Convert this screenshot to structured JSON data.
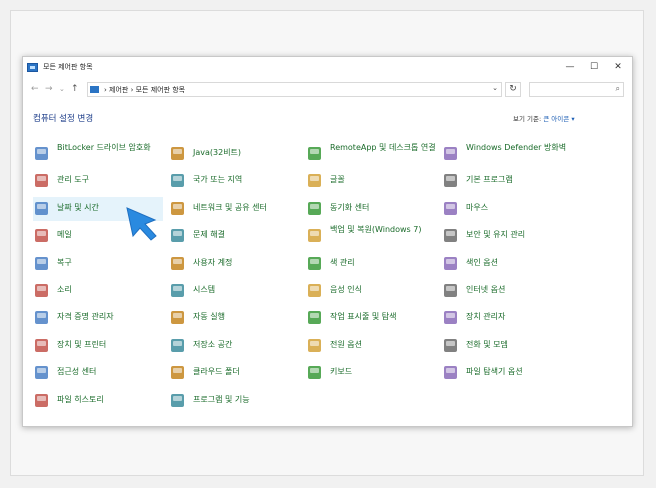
{
  "window": {
    "title": "모든 제어판 항목",
    "min_glyph": "—",
    "max_glyph": "☐",
    "close_glyph": "✕"
  },
  "nav": {
    "back_glyph": "←",
    "forward_glyph": "→",
    "dropdown_glyph": "⌄",
    "up_glyph": "↑",
    "address": "›  제어판  ›  모든 제어판 항목",
    "address_drop": "⌄",
    "refresh_glyph": "↻",
    "search_glyph": "⌕"
  },
  "page": {
    "title": "컴퓨터 설정 변경",
    "view_by_label": "보기 기준:",
    "view_by_value": "큰 아이콘 ▾"
  },
  "items": [
    {
      "label": "BitLocker 드라이브 암호화",
      "icon": "bitlocker-icon"
    },
    {
      "label": "Java(32비트)",
      "icon": "java-icon"
    },
    {
      "label": "RemoteApp 및 데스크톱 연결",
      "icon": "remoteapp-icon"
    },
    {
      "label": "Windows Defender 방화벽",
      "icon": "firewall-icon"
    },
    {
      "label": "관리 도구",
      "icon": "admin-tools-icon"
    },
    {
      "label": "국가 또는 지역",
      "icon": "region-icon"
    },
    {
      "label": "글꼴",
      "icon": "fonts-icon"
    },
    {
      "label": "기본 프로그램",
      "icon": "default-programs-icon"
    },
    {
      "label": "날짜 및 시간",
      "icon": "date-time-icon"
    },
    {
      "label": "네트워크 및 공유 센터",
      "icon": "network-icon"
    },
    {
      "label": "동기화 센터",
      "icon": "sync-icon"
    },
    {
      "label": "마우스",
      "icon": "mouse-icon"
    },
    {
      "label": "메일",
      "icon": "mail-icon"
    },
    {
      "label": "문제 해결",
      "icon": "troubleshoot-icon"
    },
    {
      "label": "백업 및 복원(Windows 7)",
      "icon": "backup-icon"
    },
    {
      "label": "보안 및 유지 관리",
      "icon": "security-flag-icon"
    },
    {
      "label": "복구",
      "icon": "recovery-icon"
    },
    {
      "label": "사용자 계정",
      "icon": "user-accounts-icon"
    },
    {
      "label": "색 관리",
      "icon": "color-icon"
    },
    {
      "label": "색인 옵션",
      "icon": "indexing-icon"
    },
    {
      "label": "소리",
      "icon": "sound-icon"
    },
    {
      "label": "시스템",
      "icon": "system-icon"
    },
    {
      "label": "음성 인식",
      "icon": "microphone-icon"
    },
    {
      "label": "인터넷 옵션",
      "icon": "internet-icon"
    },
    {
      "label": "자격 증명 관리자",
      "icon": "credential-icon"
    },
    {
      "label": "자동 실행",
      "icon": "autoplay-icon"
    },
    {
      "label": "작업 표시줄 및 탐색",
      "icon": "taskbar-icon"
    },
    {
      "label": "장치 관리자",
      "icon": "device-manager-icon"
    },
    {
      "label": "장치 및 프린터",
      "icon": "printer-icon"
    },
    {
      "label": "저장소 공간",
      "icon": "storage-icon"
    },
    {
      "label": "전원 옵션",
      "icon": "power-icon"
    },
    {
      "label": "전화 및 모뎀",
      "icon": "phone-icon"
    },
    {
      "label": "접근성 센터",
      "icon": "accessibility-icon"
    },
    {
      "label": "클라우드 폴더",
      "icon": "cloud-folder-icon"
    },
    {
      "label": "키보드",
      "icon": "keyboard-icon"
    },
    {
      "label": "파일 탐색기 옵션",
      "icon": "folder-options-icon"
    },
    {
      "label": "파일 히스토리",
      "icon": "file-history-icon"
    },
    {
      "label": "프로그램 및 기능",
      "icon": "programs-icon"
    }
  ],
  "selected_index": 8
}
